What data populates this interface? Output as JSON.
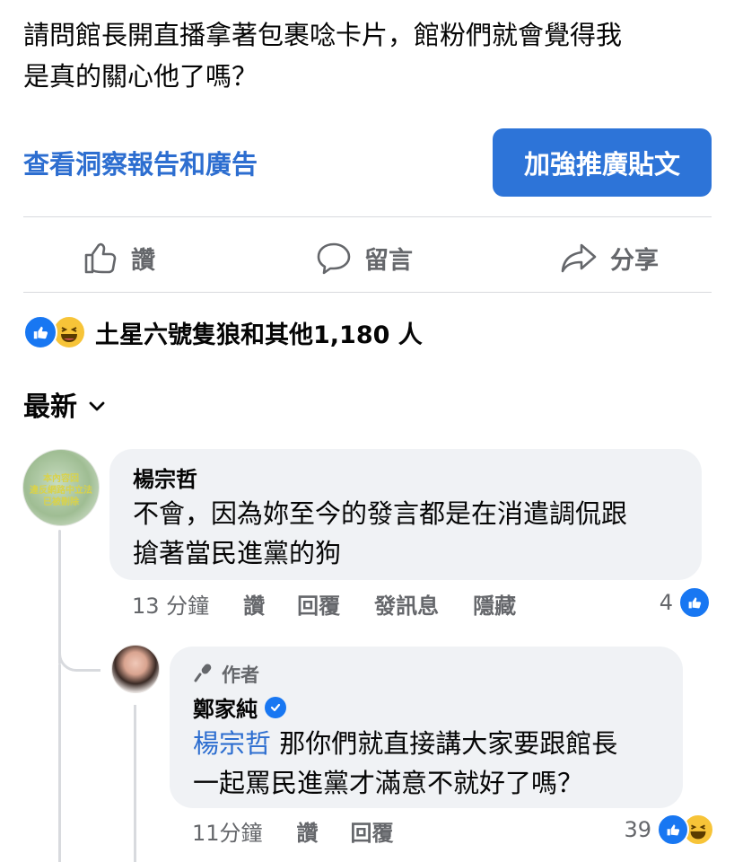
{
  "post": {
    "text_lines": [
      "請問館長開直播拿著包裹唸卡片，館粉們就會覺得我",
      "是真的關心他了嗎？"
    ]
  },
  "actions_bar": {
    "insights_link": "查看洞察報告和廣告",
    "boost_button": "加強推廣貼文",
    "like": "讚",
    "comment": "留言",
    "share": "分享"
  },
  "reactions": {
    "summary": "土星六號隻狼和其他1,180 人",
    "icons": [
      "like-icon",
      "haha-icon"
    ]
  },
  "sort": {
    "label": "最新",
    "icon": "chevron-down-icon"
  },
  "comments": [
    {
      "author": "楊宗哲",
      "avatar_text": [
        "本內容因",
        "違反網路中立法",
        "已被刪除"
      ],
      "text_lines": [
        "不會，因為妳至今的發言都是在消遣調侃跟",
        "搶著當民進黨的狗"
      ],
      "time": "13 分鐘",
      "like_label": "讚",
      "reply_label": "回覆",
      "message_label": "發訊息",
      "hide_label": "隱藏",
      "reaction_count": "4"
    }
  ],
  "reply": {
    "badge": "作者",
    "author": "鄭家純",
    "mention": "楊宗哲",
    "text_line1": " 那你們就直接講大家要跟館長",
    "text_line2": "一起罵民進黨才滿意不就好了嗎？",
    "time": "11分鐘",
    "like_label": "讚",
    "reply_label": "回覆",
    "reaction_count": "39"
  },
  "colors": {
    "link": "#2d6ed0",
    "button": "#2d74d8",
    "like": "#1877f2",
    "haha": "#f7c438",
    "muted": "#65676b"
  }
}
